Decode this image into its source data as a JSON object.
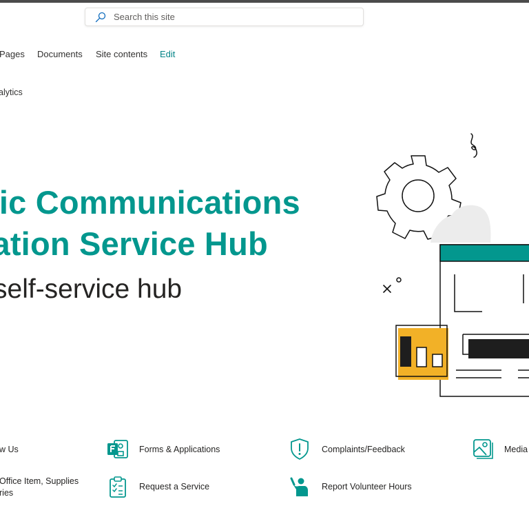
{
  "search": {
    "placeholder": "Search this site"
  },
  "nav": {
    "items": [
      {
        "label": "Pages"
      },
      {
        "label": "Documents"
      },
      {
        "label": "Site contents"
      },
      {
        "label": "Edit"
      }
    ]
  },
  "subnav": {
    "label": "alytics"
  },
  "hero": {
    "title_line1": "gic Communications",
    "title_line2": "ration Service Hub",
    "subtitle": "self-service hub"
  },
  "quick_links": [
    {
      "label": "w Us",
      "icon": "people-icon"
    },
    {
      "label": "Forms & Applications",
      "icon": "forms-icon"
    },
    {
      "label": "Complaints/Feedback",
      "icon": "shield-alert-icon"
    },
    {
      "label": "Media",
      "icon": "image-icon"
    },
    {
      "label": "Office Item, Supplies",
      "label_line2": "ries",
      "icon": "supplies-icon"
    },
    {
      "label": "Request a Service",
      "icon": "clipboard-icon"
    },
    {
      "label": "Report Volunteer Hours",
      "icon": "volunteer-icon"
    }
  ],
  "colors": {
    "accent": "#03978e",
    "edit_link": "#038387",
    "highlight": "#f2b127",
    "text": "#252423"
  }
}
